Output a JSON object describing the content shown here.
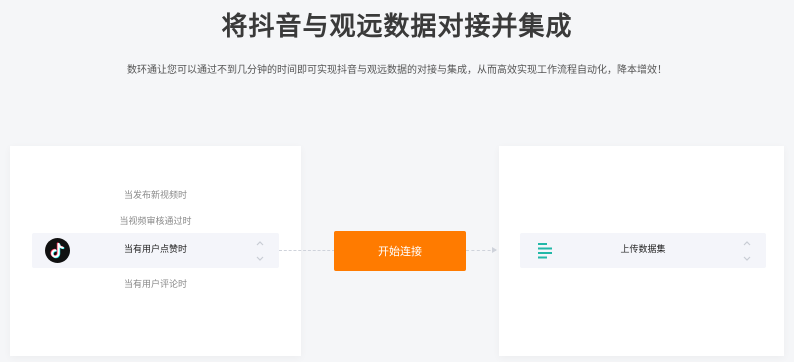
{
  "page": {
    "title": "将抖音与观远数据对接并集成",
    "subtitle": "数环通让您可以通过不到几分钟的时间即可实现抖音与观远数据的对接与集成，从而高效实现工作流程自动化，降本增效！"
  },
  "trigger_panel": {
    "app_icon": "tiktok-icon",
    "options": [
      "当发布新视频时",
      "当视频审核通过时",
      "当有用户点赞时",
      "当有用户评论时"
    ],
    "selected": "当有用户点赞时"
  },
  "connect_button": {
    "label": "开始连接",
    "color": "#ff7b00"
  },
  "action_panel": {
    "app_icon": "guanyuan-data-icon",
    "selected": "上传数据集",
    "icon_color": "#22b8a8"
  }
}
